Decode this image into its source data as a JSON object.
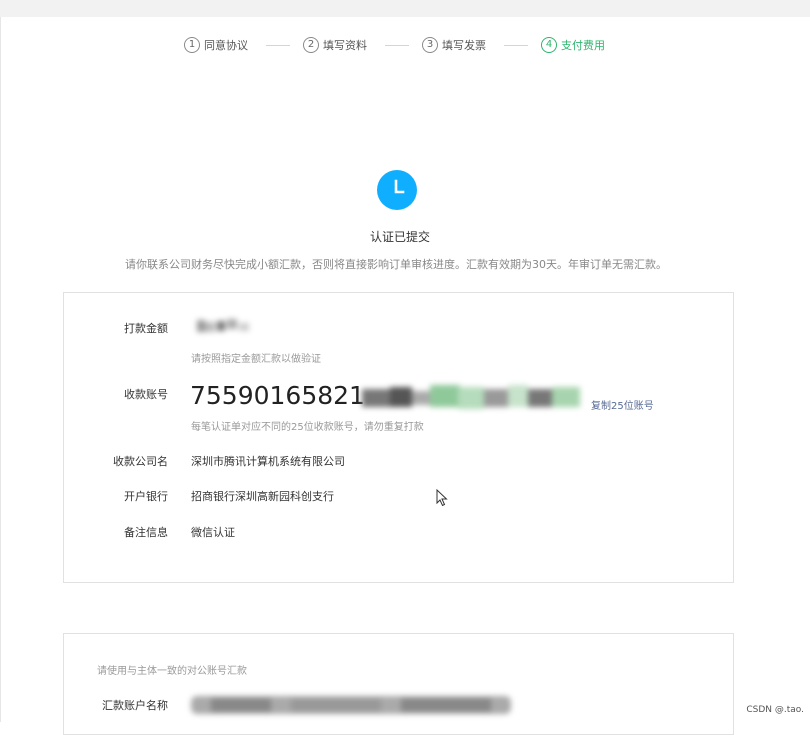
{
  "steps": [
    {
      "num": "1",
      "label": "同意协议"
    },
    {
      "num": "2",
      "label": "填写资料"
    },
    {
      "num": "3",
      "label": "填写发票"
    },
    {
      "num": "4",
      "label": "支付费用"
    }
  ],
  "active_step": 4,
  "status": {
    "icon": "clock-icon",
    "color": "#10aeff",
    "title": "认证已提交",
    "description": "请你联系公司财务尽快完成小额汇款，否则将直接影响订单审核进度。汇款有效期为30天。年审订单无需汇款。"
  },
  "payment_info": {
    "amount_label": "打款金额",
    "amount_hint": "请按照指定金额汇款以做验证",
    "account_label": "收款账号",
    "account_number_visible": "75590165821",
    "copy_label": "复制25位账号",
    "account_hint": "每笔认证单对应不同的25位收款账号，请勿重复打款",
    "company_label": "收款公司名",
    "company_value": "深圳市腾讯计算机系统有限公司",
    "bank_label": "开户银行",
    "bank_value": "招商银行深圳高新园科创支行",
    "remark_label": "备注信息",
    "remark_value": "微信认证"
  },
  "remitter": {
    "hint": "请使用与主体一致的对公账号汇款",
    "name_label": "汇款账户名称"
  },
  "watermark": "CSDN @.tao.",
  "colors": {
    "accent_green": "#2fb46d",
    "link_blue": "#576b95",
    "status_blue": "#10aeff"
  }
}
